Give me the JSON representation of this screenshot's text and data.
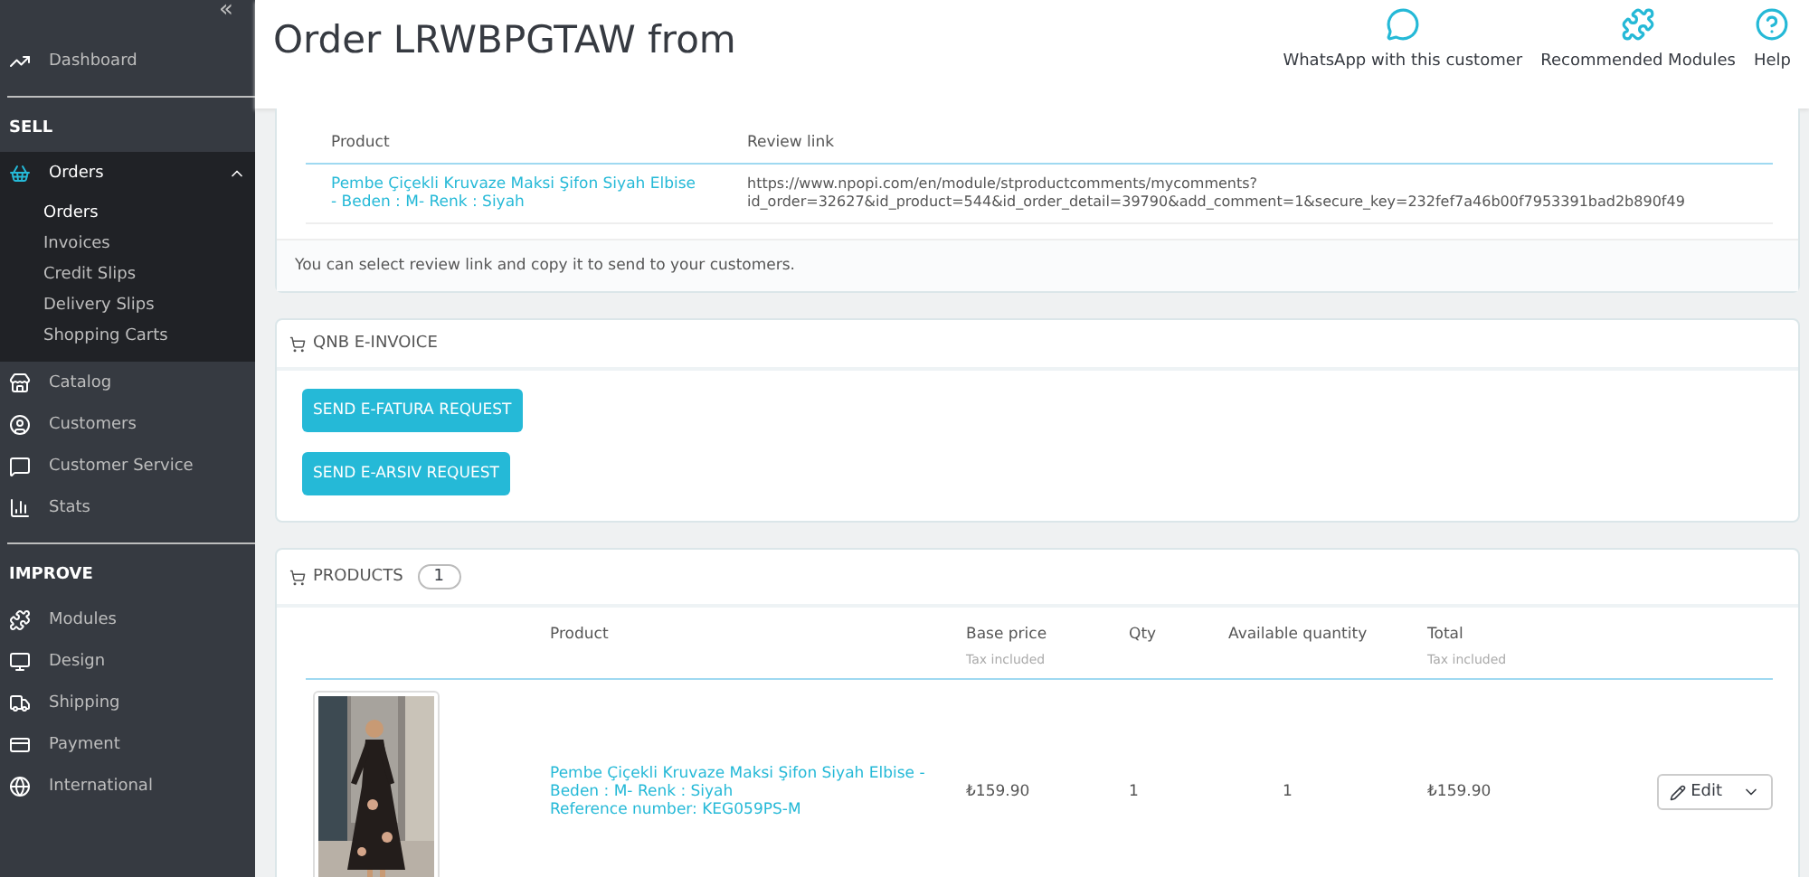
{
  "sidebar": {
    "collapse_label": "«",
    "top": [
      {
        "label": "Dashboard",
        "selected": false
      }
    ],
    "sections": [
      {
        "title": "SELL",
        "items": [
          {
            "label": "Orders",
            "selected": true,
            "expanded": true,
            "children": [
              {
                "label": "Orders",
                "selected": true
              },
              {
                "label": "Invoices",
                "selected": false
              },
              {
                "label": "Credit Slips",
                "selected": false
              },
              {
                "label": "Delivery Slips",
                "selected": false
              },
              {
                "label": "Shopping Carts",
                "selected": false
              }
            ]
          },
          {
            "label": "Catalog",
            "selected": false
          },
          {
            "label": "Customers",
            "selected": false
          },
          {
            "label": "Customer Service",
            "selected": false
          },
          {
            "label": "Stats",
            "selected": false
          }
        ]
      },
      {
        "title": "IMPROVE",
        "items": [
          {
            "label": "Modules",
            "selected": false
          },
          {
            "label": "Design",
            "selected": false
          },
          {
            "label": "Shipping",
            "selected": false
          },
          {
            "label": "Payment",
            "selected": false
          },
          {
            "label": "International",
            "selected": false
          }
        ]
      }
    ]
  },
  "header": {
    "title": "Order LRWBPGTAW from",
    "actions": [
      {
        "label": "WhatsApp with this customer"
      },
      {
        "label": "Recommended Modules"
      },
      {
        "label": "Help"
      }
    ]
  },
  "review_panel": {
    "columns": [
      "Product",
      "Review link"
    ],
    "rows": [
      {
        "product": "Pembe Çiçekli Kruvaze Maksi Şifon Siyah Elbise - Beden : M- Renk : Siyah",
        "link": "https://www.npopi.com/en/module/stproductcomments/mycomments?\nid_order=32627&id_product=544&id_order_detail=39790&add_comment=1&secure_key=232fef7a46b00f7953391bad2b890f49"
      }
    ],
    "note": "You can select review link and copy it to send to your customers."
  },
  "invoice_panel": {
    "title": "QNB E-INVOICE",
    "buttons": [
      "SEND E-FATURA REQUEST",
      "SEND E-ARSIV REQUEST"
    ]
  },
  "products_panel": {
    "title": "PRODUCTS",
    "count": "1",
    "columns": [
      {
        "label": "Product"
      },
      {
        "label": "Base price",
        "sub": "Tax included"
      },
      {
        "label": "Qty"
      },
      {
        "label": "Available quantity"
      },
      {
        "label": "Total",
        "sub": "Tax included"
      }
    ],
    "rows": [
      {
        "name": "Pembe Çiçekli Kruvaze Maksi Şifon Siyah Elbise - Beden : M- Renk : Siyah",
        "reference": "Reference number: KEG059PS-M",
        "base_price": "₺159.90",
        "qty": "1",
        "available": "1",
        "total": "₺159.90",
        "action": "Edit"
      }
    ]
  }
}
